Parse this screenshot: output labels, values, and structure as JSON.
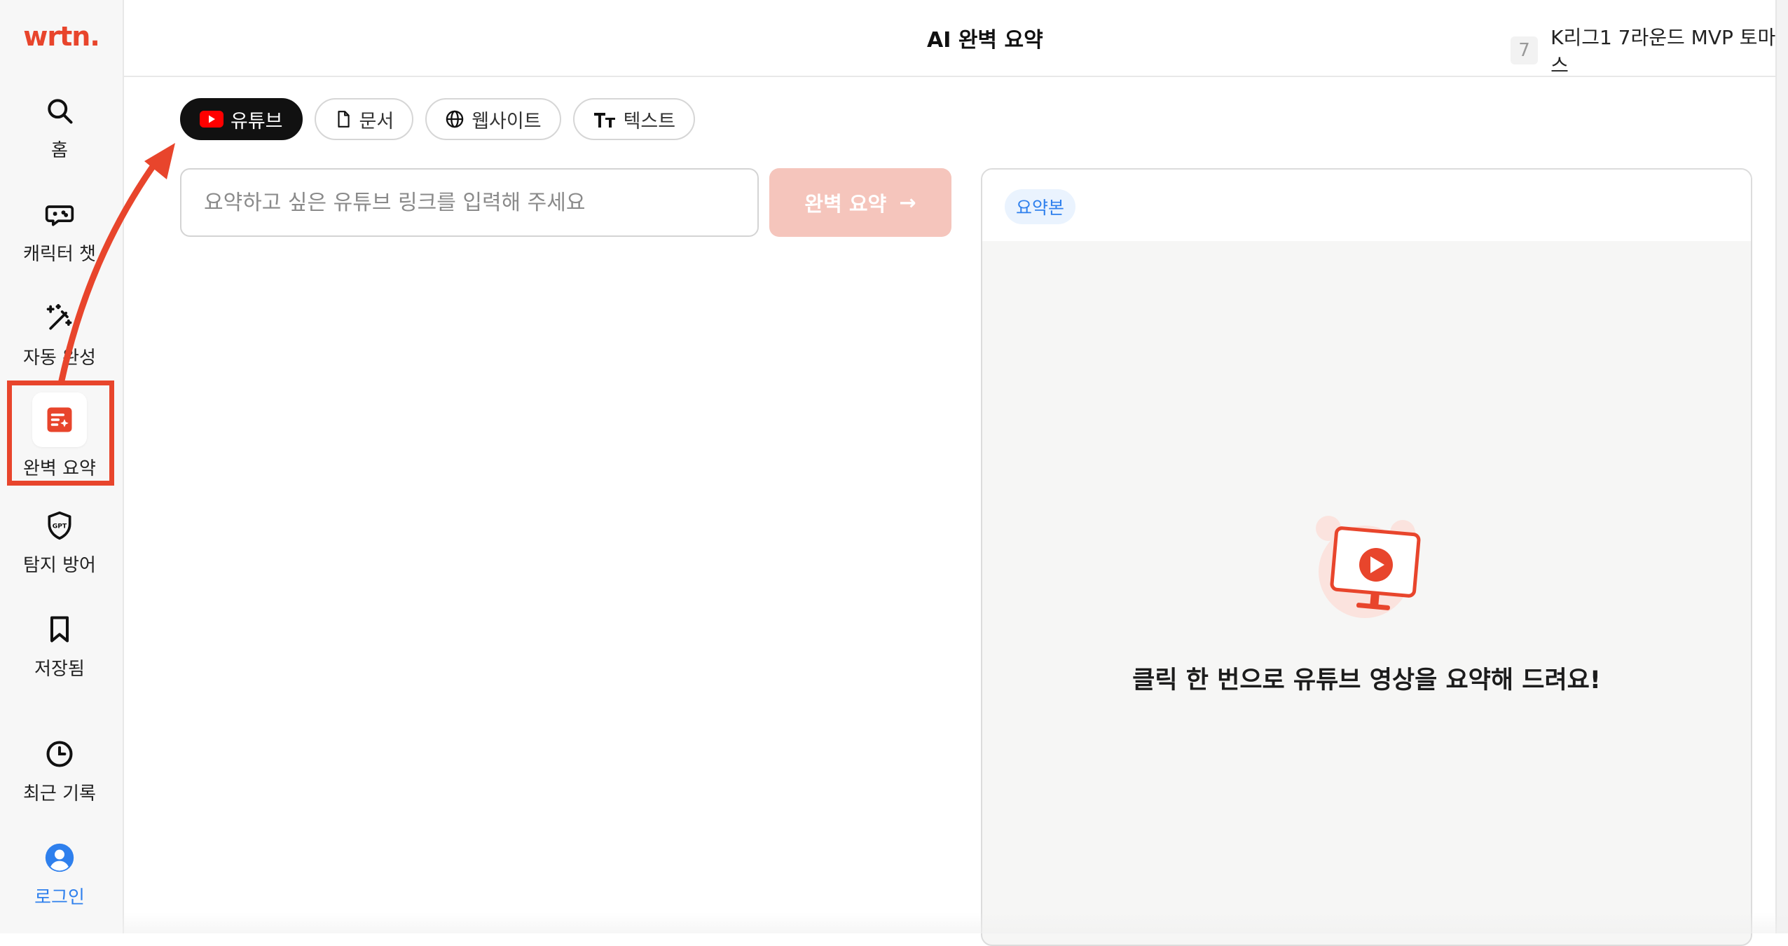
{
  "app": {
    "logo": "wrtn."
  },
  "sidebar": {
    "items": [
      {
        "id": "home",
        "label": "홈",
        "icon": "search-icon"
      },
      {
        "id": "character-chat",
        "label": "캐릭터 챗",
        "icon": "gamepad-chat-icon"
      },
      {
        "id": "autocomplete",
        "label": "자동 완성",
        "icon": "magic-wand-icon"
      },
      {
        "id": "summary",
        "label": "완벽 요약",
        "icon": "summary-doc-icon",
        "active": true
      },
      {
        "id": "detect-defense",
        "label": "탐지 방어",
        "icon": "gpt-shield-icon"
      },
      {
        "id": "saved",
        "label": "저장됨",
        "icon": "bookmark-icon"
      },
      {
        "id": "history",
        "label": "최근 기록",
        "icon": "clock-icon"
      },
      {
        "id": "login",
        "label": "로그인",
        "icon": "user-avatar-icon"
      }
    ]
  },
  "header": {
    "title": "AI 완벽 요약",
    "trending": {
      "rank": "7",
      "text": "K리그1 7라운드 MVP 토마스"
    }
  },
  "source_tabs": [
    {
      "label": "유튜브",
      "icon": "youtube-icon",
      "active": true
    },
    {
      "label": "문서",
      "icon": "document-icon",
      "active": false
    },
    {
      "label": "웹사이트",
      "icon": "globe-icon",
      "active": false
    },
    {
      "label": "텍스트",
      "icon": "text-icon",
      "active": false
    }
  ],
  "input": {
    "placeholder": "요약하고 싶은 유튜브 링크를 입력해 주세요",
    "value": ""
  },
  "submit": {
    "label": "완벽 요약",
    "arrow": "→"
  },
  "result_panel": {
    "badge": "요약본",
    "empty_message": "클릭 한 번으로 유튜브 영상을 요약해 드려요!"
  },
  "colors": {
    "brand": "#e8452c",
    "button_disabled": "#f5c5bc",
    "link_blue": "#2f80ed",
    "annotation_red": "#e8452c"
  }
}
